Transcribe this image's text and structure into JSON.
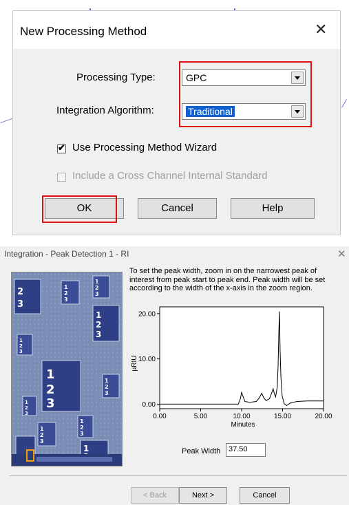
{
  "dialog1": {
    "title": "New Processing Method",
    "close_glyph": "✕",
    "processing_type": {
      "label": "Processing Type:",
      "value": "GPC"
    },
    "integration_algorithm": {
      "label": "Integration Algorithm:",
      "value": "Traditional"
    },
    "use_wizard": {
      "label": "Use Processing Method Wizard",
      "checked": true
    },
    "cross_channel": {
      "label": "Include a Cross Channel Internal Standard",
      "checked": false,
      "enabled": false
    },
    "buttons": {
      "ok": "OK",
      "cancel": "Cancel",
      "help": "Help"
    },
    "highlight_color": "#e01010"
  },
  "dialog2": {
    "title": "Integration - Peak Detection 1 - RI",
    "close_glyph": "✕",
    "instructions": "To set the peak width, zoom in on the narrowest peak of interest from peak start to peak end.  Peak width will be set according to the width of the x-axis in the zoom region.",
    "peak_width": {
      "label": "Peak Width",
      "value": "37.50"
    },
    "buttons": {
      "back": "< Back",
      "next": "Next >",
      "cancel": "Cancel"
    }
  },
  "chart_data": {
    "type": "line",
    "title": "",
    "xlabel": "Minutes",
    "ylabel": "µRIU",
    "xlim": [
      0,
      20
    ],
    "ylim": [
      -1,
      21.5
    ],
    "x_ticks": [
      "0.00",
      "5.00",
      "10.00",
      "15.00",
      "20.00"
    ],
    "y_ticks": [
      "0.00",
      "10.00",
      "20.00"
    ],
    "grid": false,
    "series": [
      {
        "values": [
          [
            0.0,
            0.0
          ],
          [
            4.0,
            0.0
          ],
          [
            9.6,
            0.0
          ],
          [
            9.85,
            1.2
          ],
          [
            10.0,
            2.6
          ],
          [
            10.15,
            1.8
          ],
          [
            10.4,
            0.6
          ],
          [
            11.0,
            0.4
          ],
          [
            11.8,
            0.6
          ],
          [
            12.2,
            1.5
          ],
          [
            12.45,
            2.4
          ],
          [
            12.7,
            1.4
          ],
          [
            13.0,
            0.8
          ],
          [
            13.4,
            1.2
          ],
          [
            13.7,
            2.6
          ],
          [
            13.85,
            3.4
          ],
          [
            14.0,
            2.3
          ],
          [
            14.15,
            1.6
          ],
          [
            14.35,
            3.8
          ],
          [
            14.45,
            8.5
          ],
          [
            14.55,
            16.0
          ],
          [
            14.62,
            20.5
          ],
          [
            14.7,
            12.0
          ],
          [
            14.8,
            6.0
          ],
          [
            14.95,
            1.8
          ],
          [
            15.2,
            0.1
          ],
          [
            15.5,
            -0.3
          ],
          [
            16.0,
            0.3
          ],
          [
            16.8,
            0.6
          ],
          [
            18.0,
            0.7
          ],
          [
            20.0,
            0.7
          ]
        ]
      }
    ]
  }
}
